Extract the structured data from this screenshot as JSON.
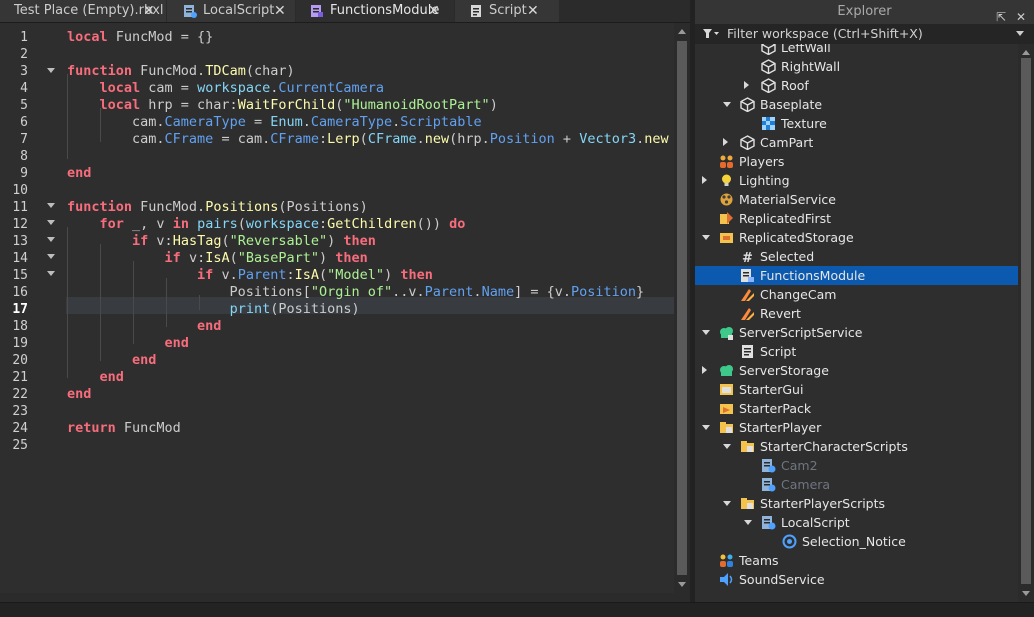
{
  "tabs": [
    {
      "label": "Test Place (Empty).rbxl",
      "close": "✕"
    },
    {
      "label": "LocalScript",
      "close": "✕"
    },
    {
      "label": "FunctionsModule",
      "close": "✕"
    },
    {
      "label": "Script",
      "close": "✕"
    }
  ],
  "editor": {
    "line_numbers": [
      "1",
      "2",
      "3",
      "4",
      "5",
      "6",
      "7",
      "8",
      "9",
      "10",
      "11",
      "12",
      "13",
      "14",
      "15",
      "16",
      "17",
      "18",
      "19",
      "20",
      "21",
      "22",
      "23",
      "24",
      "25"
    ],
    "current_line": "17",
    "lines": [
      [
        [
          "k",
          "local"
        ],
        [
          "t",
          " FuncMod = {}"
        ]
      ],
      [],
      [
        [
          "k",
          "function"
        ],
        [
          "t",
          " FuncMod."
        ],
        [
          "f",
          "TDCam"
        ],
        [
          "t",
          "(char)"
        ]
      ],
      [
        [
          "t",
          "    "
        ],
        [
          "k",
          "local"
        ],
        [
          "t",
          " cam = "
        ],
        [
          "b",
          "workspace"
        ],
        [
          "t",
          "."
        ],
        [
          "p",
          "CurrentCamera"
        ]
      ],
      [
        [
          "t",
          "    "
        ],
        [
          "k",
          "local"
        ],
        [
          "t",
          " hrp = char:"
        ],
        [
          "f",
          "WaitForChild"
        ],
        [
          "t",
          "("
        ],
        [
          "s",
          "\"HumanoidRootPart\""
        ],
        [
          "t",
          ")"
        ]
      ],
      [
        [
          "t",
          "        cam."
        ],
        [
          "p",
          "CameraType"
        ],
        [
          "t",
          " = "
        ],
        [
          "b",
          "Enum"
        ],
        [
          "t",
          "."
        ],
        [
          "p",
          "CameraType"
        ],
        [
          "t",
          "."
        ],
        [
          "p",
          "Scriptable"
        ]
      ],
      [
        [
          "t",
          "        cam."
        ],
        [
          "p",
          "CFrame"
        ],
        [
          "t",
          " = cam."
        ],
        [
          "p",
          "CFrame"
        ],
        [
          "t",
          ":"
        ],
        [
          "f",
          "Lerp"
        ],
        [
          "t",
          "("
        ],
        [
          "b",
          "CFrame"
        ],
        [
          "t",
          "."
        ],
        [
          "f",
          "new"
        ],
        [
          "t",
          "(hrp."
        ],
        [
          "p",
          "Position"
        ],
        [
          "t",
          " + "
        ],
        [
          "b",
          "Vector3"
        ],
        [
          "t",
          "."
        ],
        [
          "f",
          "new"
        ]
      ],
      [],
      [
        [
          "k",
          "end"
        ]
      ],
      [],
      [
        [
          "k",
          "function"
        ],
        [
          "t",
          " FuncMod."
        ],
        [
          "f",
          "Positions"
        ],
        [
          "t",
          "(Positions)"
        ]
      ],
      [
        [
          "t",
          "    "
        ],
        [
          "k",
          "for"
        ],
        [
          "t",
          " _, v "
        ],
        [
          "k",
          "in"
        ],
        [
          "t",
          " "
        ],
        [
          "b",
          "pairs"
        ],
        [
          "t",
          "("
        ],
        [
          "b",
          "workspace"
        ],
        [
          "t",
          ":"
        ],
        [
          "f",
          "GetChildren"
        ],
        [
          "t",
          "()) "
        ],
        [
          "k",
          "do"
        ]
      ],
      [
        [
          "t",
          "        "
        ],
        [
          "k",
          "if"
        ],
        [
          "t",
          " v:"
        ],
        [
          "f",
          "HasTag"
        ],
        [
          "t",
          "("
        ],
        [
          "s",
          "\"Reversable\""
        ],
        [
          "t",
          ") "
        ],
        [
          "k",
          "then"
        ]
      ],
      [
        [
          "t",
          "            "
        ],
        [
          "k",
          "if"
        ],
        [
          "t",
          " v:"
        ],
        [
          "f",
          "IsA"
        ],
        [
          "t",
          "("
        ],
        [
          "s",
          "\"BasePart\""
        ],
        [
          "t",
          ") "
        ],
        [
          "k",
          "then"
        ]
      ],
      [
        [
          "t",
          "                "
        ],
        [
          "k",
          "if"
        ],
        [
          "t",
          " v."
        ],
        [
          "p",
          "Parent"
        ],
        [
          "t",
          ":"
        ],
        [
          "f",
          "IsA"
        ],
        [
          "t",
          "("
        ],
        [
          "s",
          "\"Model\""
        ],
        [
          "t",
          ") "
        ],
        [
          "k",
          "then"
        ]
      ],
      [
        [
          "t",
          "                    Positions["
        ],
        [
          "s",
          "\"Orgin of\""
        ],
        [
          "t",
          "..v."
        ],
        [
          "p",
          "Parent"
        ],
        [
          "t",
          "."
        ],
        [
          "p",
          "Name"
        ],
        [
          "t",
          "] = {v."
        ],
        [
          "p",
          "Position"
        ],
        [
          "t",
          "}"
        ]
      ],
      [
        [
          "t",
          "                    "
        ],
        [
          "b",
          "print"
        ],
        [
          "t",
          "(Positions)"
        ]
      ],
      [
        [
          "t",
          "                "
        ],
        [
          "k",
          "end"
        ]
      ],
      [
        [
          "t",
          "            "
        ],
        [
          "k",
          "end"
        ]
      ],
      [
        [
          "t",
          "        "
        ],
        [
          "k",
          "end"
        ]
      ],
      [
        [
          "t",
          "    "
        ],
        [
          "k",
          "end"
        ]
      ],
      [
        [
          "k",
          "end"
        ]
      ],
      [],
      [
        [
          "k",
          "return"
        ],
        [
          "t",
          " FuncMod"
        ]
      ],
      []
    ]
  },
  "explorer": {
    "title": "Explorer",
    "filter_placeholder": "Filter workspace (Ctrl+Shift+X)",
    "items": [
      {
        "label": "LeftWall",
        "icon": "part-icon"
      },
      {
        "label": "RightWall",
        "icon": "part-icon"
      },
      {
        "label": "Roof",
        "icon": "part-icon"
      },
      {
        "label": "Baseplate",
        "icon": "part-icon"
      },
      {
        "label": "Texture",
        "icon": "texture-icon"
      },
      {
        "label": "CamPart",
        "icon": "part-icon"
      },
      {
        "label": "Players",
        "icon": "players-icon"
      },
      {
        "label": "Lighting",
        "icon": "lightbulb-icon"
      },
      {
        "label": "MaterialService",
        "icon": "material-service-icon"
      },
      {
        "label": "ReplicatedFirst",
        "icon": "replicated-first-icon"
      },
      {
        "label": "ReplicatedStorage",
        "icon": "replicated-storage-icon"
      },
      {
        "label": "Selected",
        "icon": "value-icon"
      },
      {
        "label": "FunctionsModule",
        "icon": "module-script-icon"
      },
      {
        "label": "ChangeCam",
        "icon": "remote-event-icon"
      },
      {
        "label": "Revert",
        "icon": "remote-event-icon"
      },
      {
        "label": "ServerScriptService",
        "icon": "server-script-service-icon"
      },
      {
        "label": "Script",
        "icon": "script-icon"
      },
      {
        "label": "ServerStorage",
        "icon": "server-storage-icon"
      },
      {
        "label": "StarterGui",
        "icon": "starter-gui-icon"
      },
      {
        "label": "StarterPack",
        "icon": "starter-pack-icon"
      },
      {
        "label": "StarterPlayer",
        "icon": "folder-icon"
      },
      {
        "label": "StarterCharacterScripts",
        "icon": "folder-icon"
      },
      {
        "label": "Cam2",
        "icon": "local-script-icon"
      },
      {
        "label": "Camera",
        "icon": "local-script-icon"
      },
      {
        "label": "StarterPlayerScripts",
        "icon": "folder-icon"
      },
      {
        "label": "LocalScript",
        "icon": "local-script-icon"
      },
      {
        "label": "Selection_Notice",
        "icon": "sound-icon"
      },
      {
        "label": "Teams",
        "icon": "teams-icon"
      },
      {
        "label": "SoundService",
        "icon": "sound-service-icon"
      }
    ]
  },
  "colors": {
    "keyword": "#f86d7c",
    "function": "#fdfbac",
    "builtin": "#84d6f7",
    "string": "#adf195",
    "property": "#61a1f1",
    "selection": "#0b5aaf"
  }
}
